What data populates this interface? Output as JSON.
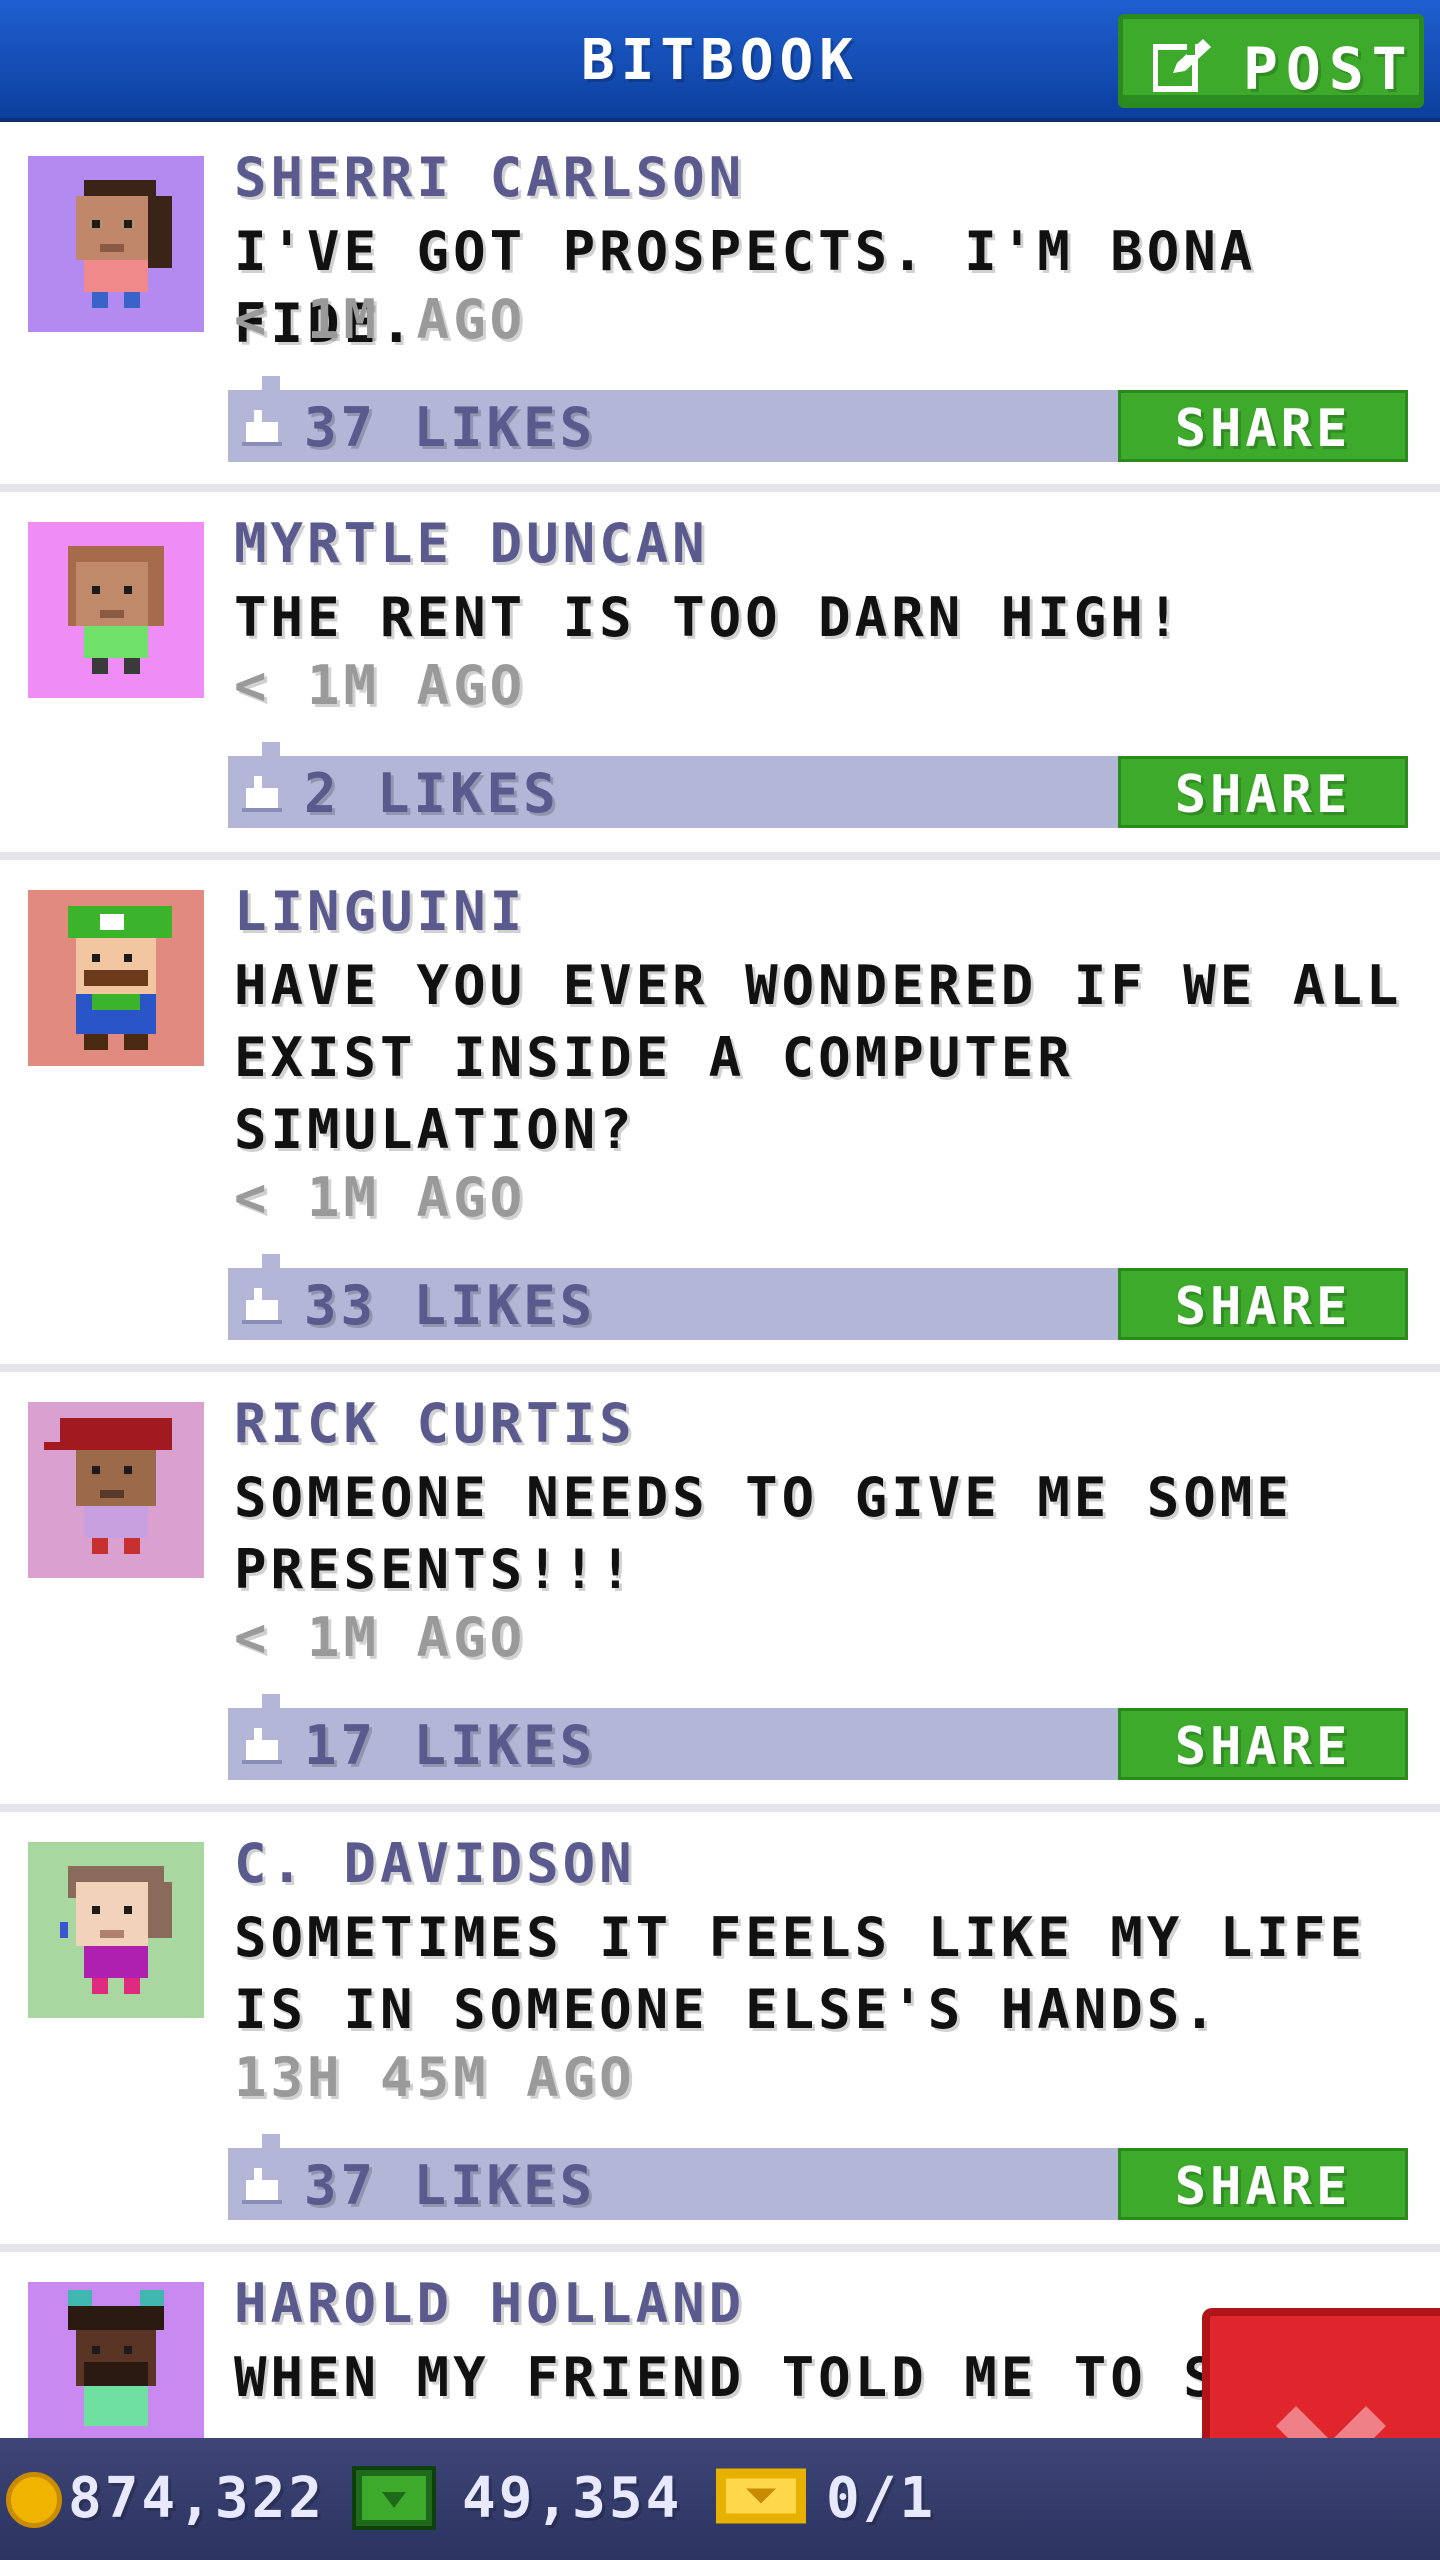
{
  "header": {
    "title": "BITBOOK",
    "post_label": "POST"
  },
  "posts": [
    {
      "author": "SHERRI CARLSON",
      "message": "I'VE GOT PROSPECTS. I'M BONA FIDE.",
      "time": "< 1M AGO",
      "likes": "37 LIKES",
      "share": "SHARE"
    },
    {
      "author": "MYRTLE DUNCAN",
      "message": "THE RENT IS TOO DARN HIGH!",
      "time": "< 1M AGO",
      "likes": "2 LIKES",
      "share": "SHARE"
    },
    {
      "author": "LINGUINI",
      "message": "HAVE YOU EVER WONDERED IF WE ALL EXIST INSIDE A COMPUTER SIMULATION?",
      "time": "< 1M AGO",
      "likes": "33 LIKES",
      "share": "SHARE"
    },
    {
      "author": "RICK CURTIS",
      "message": "SOMEONE NEEDS TO GIVE ME SOME PRESENTS!!!",
      "time": "< 1M AGO",
      "likes": "17 LIKES",
      "share": "SHARE"
    },
    {
      "author": "C. DAVIDSON",
      "message": "SOMETIMES IT FEELS LIKE MY LIFE IS IN SOMEONE ELSE'S HANDS.",
      "time": "13H 45M AGO",
      "likes": "37 LIKES",
      "share": "SHARE"
    },
    {
      "author": "HAROLD HOLLAND",
      "message": "WHEN MY FRIEND TOLD ME TO ST"
    }
  ],
  "status": {
    "coins": "874,322",
    "cash": "49,354",
    "tickets": "0/1"
  },
  "colors": {
    "header_blue": "#1f5fd0",
    "button_green": "#3daa2c",
    "likes_bar": "#b3b6d6",
    "author_purple": "#5a5a8e",
    "close_red": "#e0262c"
  },
  "icons": {
    "post": "edit-icon",
    "like": "thumbs-up-icon",
    "coin": "coin-icon",
    "cash": "cash-icon",
    "ticket": "ticket-icon",
    "close": "close-icon"
  }
}
